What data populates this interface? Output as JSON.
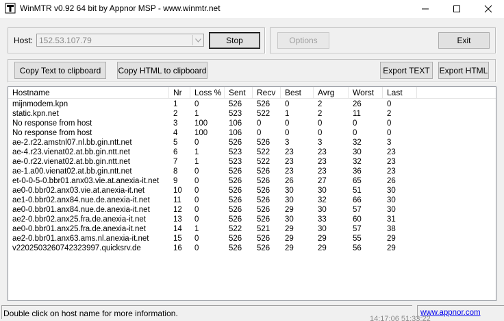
{
  "window": {
    "title": "WinMTR v0.92 64 bit by Appnor MSP - www.winmtr.net"
  },
  "controls": {
    "host_label": "Host:",
    "host_value": "152.53.107.79",
    "stop_label": "Stop",
    "options_label": "Options",
    "exit_label": "Exit",
    "copy_text_label": "Copy Text to clipboard",
    "copy_html_label": "Copy HTML to clipboard",
    "export_text_label": "Export TEXT",
    "export_html_label": "Export HTML"
  },
  "table": {
    "columns": [
      "Hostname",
      "Nr",
      "Loss %",
      "Sent",
      "Recv",
      "Best",
      "Avrg",
      "Worst",
      "Last"
    ],
    "rows": [
      [
        "mijnmodem.kpn",
        "1",
        "0",
        "526",
        "526",
        "0",
        "2",
        "26",
        "0"
      ],
      [
        "static.kpn.net",
        "2",
        "1",
        "523",
        "522",
        "1",
        "2",
        "11",
        "2"
      ],
      [
        "No response from host",
        "3",
        "100",
        "106",
        "0",
        "0",
        "0",
        "0",
        "0"
      ],
      [
        "No response from host",
        "4",
        "100",
        "106",
        "0",
        "0",
        "0",
        "0",
        "0"
      ],
      [
        "ae-2.r22.amstnl07.nl.bb.gin.ntt.net",
        "5",
        "0",
        "526",
        "526",
        "3",
        "3",
        "32",
        "3"
      ],
      [
        "ae-4.r23.vienat02.at.bb.gin.ntt.net",
        "6",
        "1",
        "523",
        "522",
        "23",
        "23",
        "30",
        "23"
      ],
      [
        "ae-0.r22.vienat02.at.bb.gin.ntt.net",
        "7",
        "1",
        "523",
        "522",
        "23",
        "23",
        "32",
        "23"
      ],
      [
        "ae-1.a00.vienat02.at.bb.gin.ntt.net",
        "8",
        "0",
        "526",
        "526",
        "23",
        "23",
        "36",
        "23"
      ],
      [
        "et-0-0-5-0.bbr01.anx03.vie.at.anexia-it.net",
        "9",
        "0",
        "526",
        "526",
        "26",
        "27",
        "65",
        "26"
      ],
      [
        "ae0-0.bbr02.anx03.vie.at.anexia-it.net",
        "10",
        "0",
        "526",
        "526",
        "30",
        "30",
        "51",
        "30"
      ],
      [
        "ae1-0.bbr02.anx84.nue.de.anexia-it.net",
        "11",
        "0",
        "526",
        "526",
        "30",
        "32",
        "66",
        "30"
      ],
      [
        "ae0-0.bbr01.anx84.nue.de.anexia-it.net",
        "12",
        "0",
        "526",
        "526",
        "29",
        "30",
        "57",
        "30"
      ],
      [
        "ae2-0.bbr02.anx25.fra.de.anexia-it.net",
        "13",
        "0",
        "526",
        "526",
        "30",
        "33",
        "60",
        "31"
      ],
      [
        "ae0-0.bbr01.anx25.fra.de.anexia-it.net",
        "14",
        "1",
        "522",
        "521",
        "29",
        "30",
        "57",
        "38"
      ],
      [
        "ae2-0.bbr01.anx63.ams.nl.anexia-it.net",
        "15",
        "0",
        "526",
        "526",
        "29",
        "29",
        "55",
        "29"
      ],
      [
        "v2202503260742323997.quicksrv.de",
        "16",
        "0",
        "526",
        "526",
        "29",
        "29",
        "56",
        "29"
      ]
    ]
  },
  "statusbar": {
    "text": "Double click on host name for more information.",
    "link": "www.appnor.com",
    "overflow_text": "14:17:06 51:33:22"
  }
}
